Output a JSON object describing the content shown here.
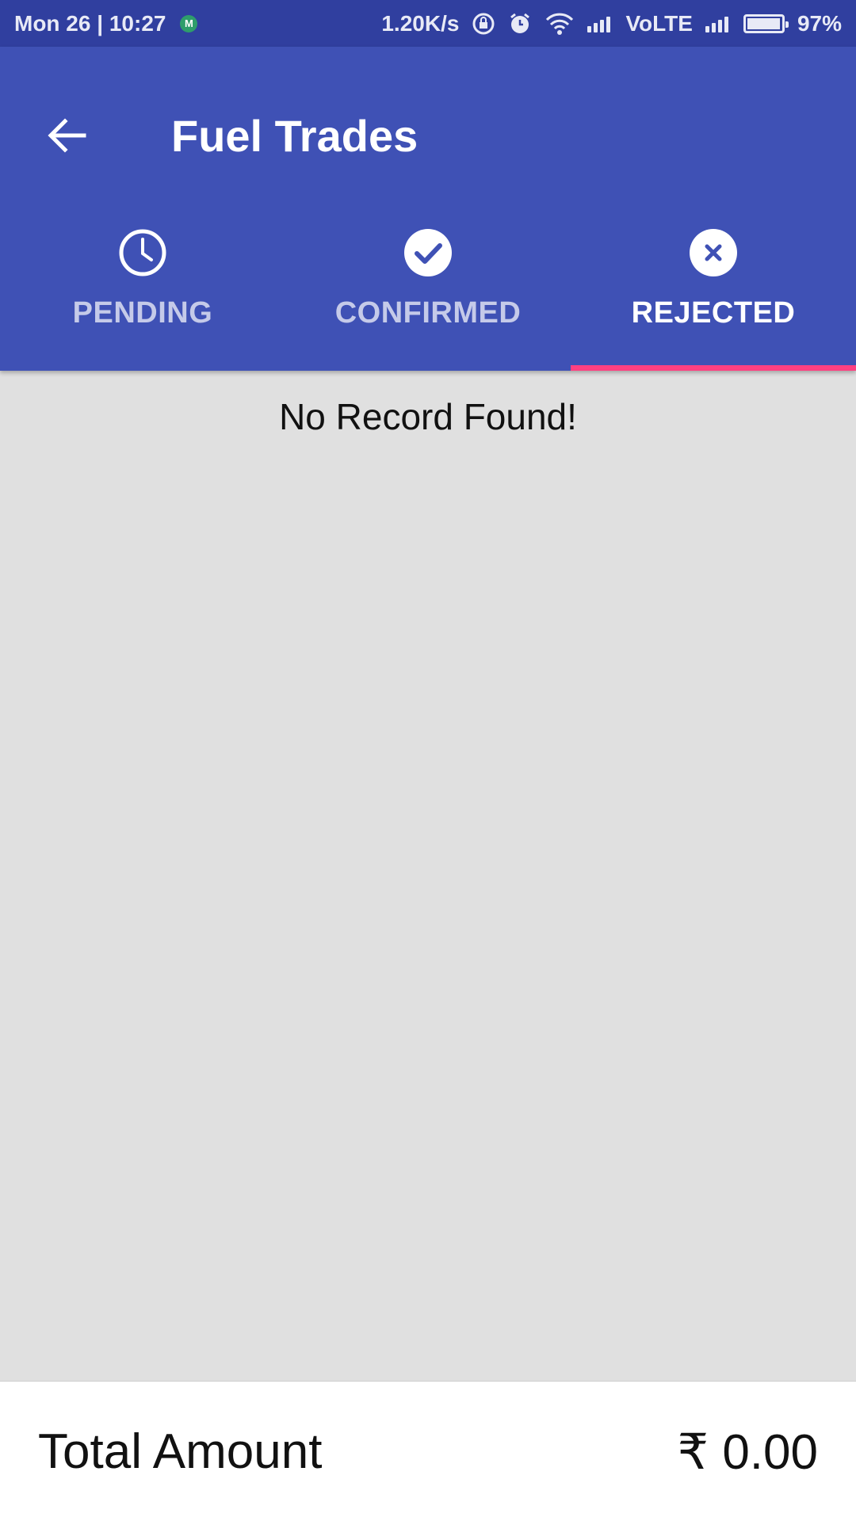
{
  "status_bar": {
    "date_time": "Mon 26 | 10:27",
    "mail_letter": "M",
    "net_speed": "1.20K/s",
    "network": "VoLTE",
    "battery": "97%",
    "battery_level": 0.97
  },
  "app_bar": {
    "title": "Fuel Trades",
    "back_icon": "arrow-back-icon"
  },
  "tabs": [
    {
      "label": "PENDING",
      "icon": "clock-icon",
      "active": false
    },
    {
      "label": "CONFIRMED",
      "icon": "check-circle-icon",
      "active": false
    },
    {
      "label": "REJECTED",
      "icon": "cancel-circle-icon",
      "active": true
    }
  ],
  "content": {
    "empty_message": "No Record Found!"
  },
  "footer": {
    "total_label": "Total Amount",
    "total_value": "₹ 0.00"
  },
  "colors": {
    "primary": "#3f51b5",
    "primary_dark": "#303f9f",
    "accent": "#ff4081",
    "background": "#e0e0e0"
  }
}
